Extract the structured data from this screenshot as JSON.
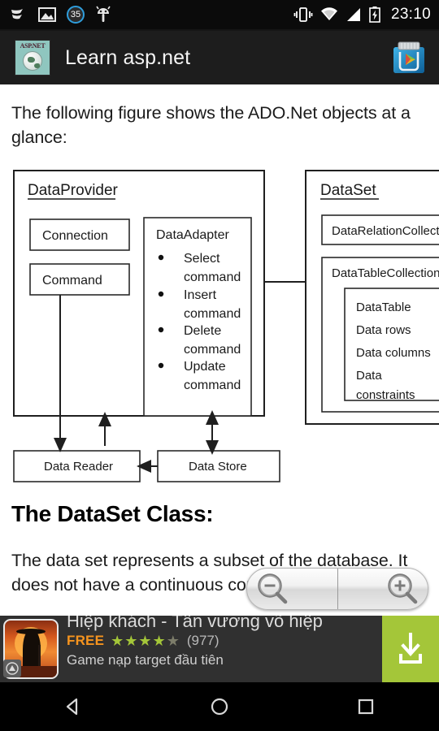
{
  "status_bar": {
    "time": "23:10",
    "left_icons": [
      "swipe-gesture-icon",
      "image-icon",
      "battery-saver-35-badge",
      "android-bug-icon"
    ],
    "badge_value": "35",
    "right_icons": [
      "vibrate-icon",
      "wifi-icon",
      "cell-signal-icon",
      "battery-charging-icon"
    ]
  },
  "action_bar": {
    "title": "Learn asp.net",
    "app_icon_text": "ASP.NET",
    "right_action": "play-store-icon"
  },
  "content": {
    "intro_paragraph": "The following figure shows the ADO.Net objects at a glance:",
    "heading": "The DataSet Class:",
    "body_paragraph": "The data set represents a subset of the database. It does not have a continuous connection to the"
  },
  "diagram": {
    "provider": {
      "title": "DataProvider",
      "connection": "Connection",
      "command": "Command",
      "adapter_title": "DataAdapter",
      "adapter_items": [
        "Select command",
        "Insert command",
        "Delete command",
        "Update command"
      ]
    },
    "dataset": {
      "title": "DataSet",
      "relation_collection": "DataRelationCollectio",
      "table_collection": "DataTableCollection",
      "table_items": [
        "DataTable",
        "Data rows",
        "Data columns",
        "Data",
        "constraints"
      ]
    },
    "bottom": {
      "data_reader": "Data Reader",
      "data_store": "Data Store"
    }
  },
  "zoom_control": {
    "zoom_out_label": "zoom-out",
    "zoom_in_label": "zoom-in"
  },
  "ad": {
    "title": "Hiệp khách - Tân vương võ hiệp",
    "price": "FREE",
    "stars": "★★★★",
    "half_star": "★",
    "rating_count": "(977)",
    "subtitle": "Game nạp target đầu tiên",
    "cta": "download-icon",
    "cta_color": "#a4c639",
    "price_color": "#f6941e",
    "star_color": "#a4c639"
  },
  "nav_bar": {
    "back": "back-icon",
    "home": "home-icon",
    "recents": "recents-icon"
  }
}
